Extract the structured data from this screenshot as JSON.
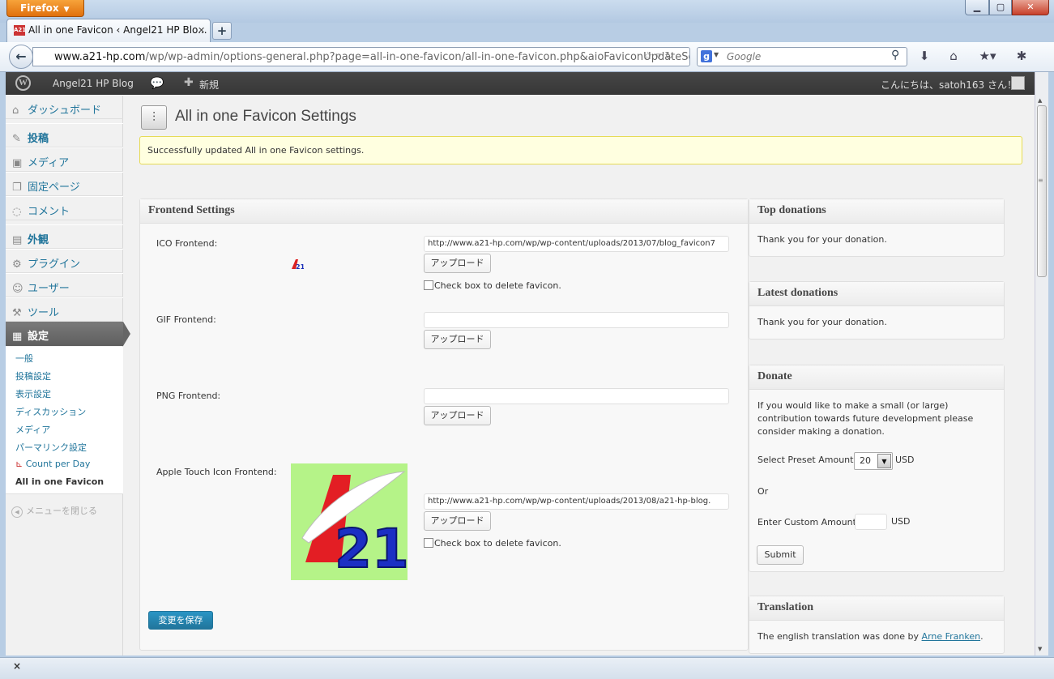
{
  "browser": {
    "app_button": "Firefox",
    "tab_title": "All in one Favicon ‹ Angel21 HP Blo...",
    "url_host": "www.a21-hp.com",
    "url_path": "/wp/wp-admin/options-general.php?page=all-in-one-favicon/all-in-one-favicon.php&aioFaviconUpdateSe",
    "search_placeholder": "Google",
    "status_close": "×"
  },
  "adminbar": {
    "site_name": "Angel21 HP Blog",
    "new_label": "新規",
    "howdy": "こんにちは、satoh163 さん！"
  },
  "sidebar": {
    "items": [
      {
        "label": "ダッシュボード",
        "icon": "home-icon"
      },
      {
        "label": "投稿",
        "icon": "pin-icon"
      },
      {
        "label": "メディア",
        "icon": "media-icon"
      },
      {
        "label": "固定ページ",
        "icon": "pages-icon"
      },
      {
        "label": "コメント",
        "icon": "comment-icon"
      },
      {
        "label": "外観",
        "icon": "appearance-icon"
      },
      {
        "label": "プラグイン",
        "icon": "plugin-icon"
      },
      {
        "label": "ユーザー",
        "icon": "users-icon"
      },
      {
        "label": "ツール",
        "icon": "tools-icon"
      },
      {
        "label": "設定",
        "icon": "settings-icon"
      }
    ],
    "submenu": [
      "一般",
      "投稿設定",
      "表示設定",
      "ディスカッション",
      "メディア",
      "パーマリンク設定",
      "Count per Day",
      "All in one Favicon"
    ],
    "collapse": "メニューを閉じる"
  },
  "main": {
    "title": "All in one Favicon Settings",
    "notice": "Successfully updated All in one Favicon settings.",
    "frontend": {
      "heading": "Frontend Settings",
      "ico_label": "ICO Frontend:",
      "ico_value": "http://www.a21-hp.com/wp/wp-content/uploads/2013/07/blog_favicon7",
      "gif_label": "GIF Frontend:",
      "gif_value": "",
      "png_label": "PNG Frontend:",
      "png_value": "",
      "apple_label": "Apple Touch Icon Frontend:",
      "apple_value": "http://www.a21-hp.com/wp/wp-content/uploads/2013/08/a21-hp-blog.",
      "upload_label": "アップロード",
      "delete_label": "Check box to delete favicon.",
      "save_label": "変更を保存"
    }
  },
  "side": {
    "top_donations": {
      "heading": "Top donations",
      "text": "Thank you for your donation."
    },
    "latest_donations": {
      "heading": "Latest donations",
      "text": "Thank you for your donation."
    },
    "donate": {
      "heading": "Donate",
      "text": "If you would like to make a small (or large) contribution towards future development please consider making a donation.",
      "preset_label": "Select Preset Amount:",
      "preset_value": "20",
      "currency": "USD",
      "or": "Or",
      "custom_label": "Enter Custom Amount:",
      "submit": "Submit"
    },
    "translation": {
      "heading": "Translation",
      "text_prefix": "The english translation was done by ",
      "link": "Arne Franken",
      "text_suffix": "."
    }
  },
  "colors": {
    "link": "#21759b",
    "notice_bg": "#ffffe0",
    "primary_button": "#21759b",
    "adminbar": "#464646"
  }
}
